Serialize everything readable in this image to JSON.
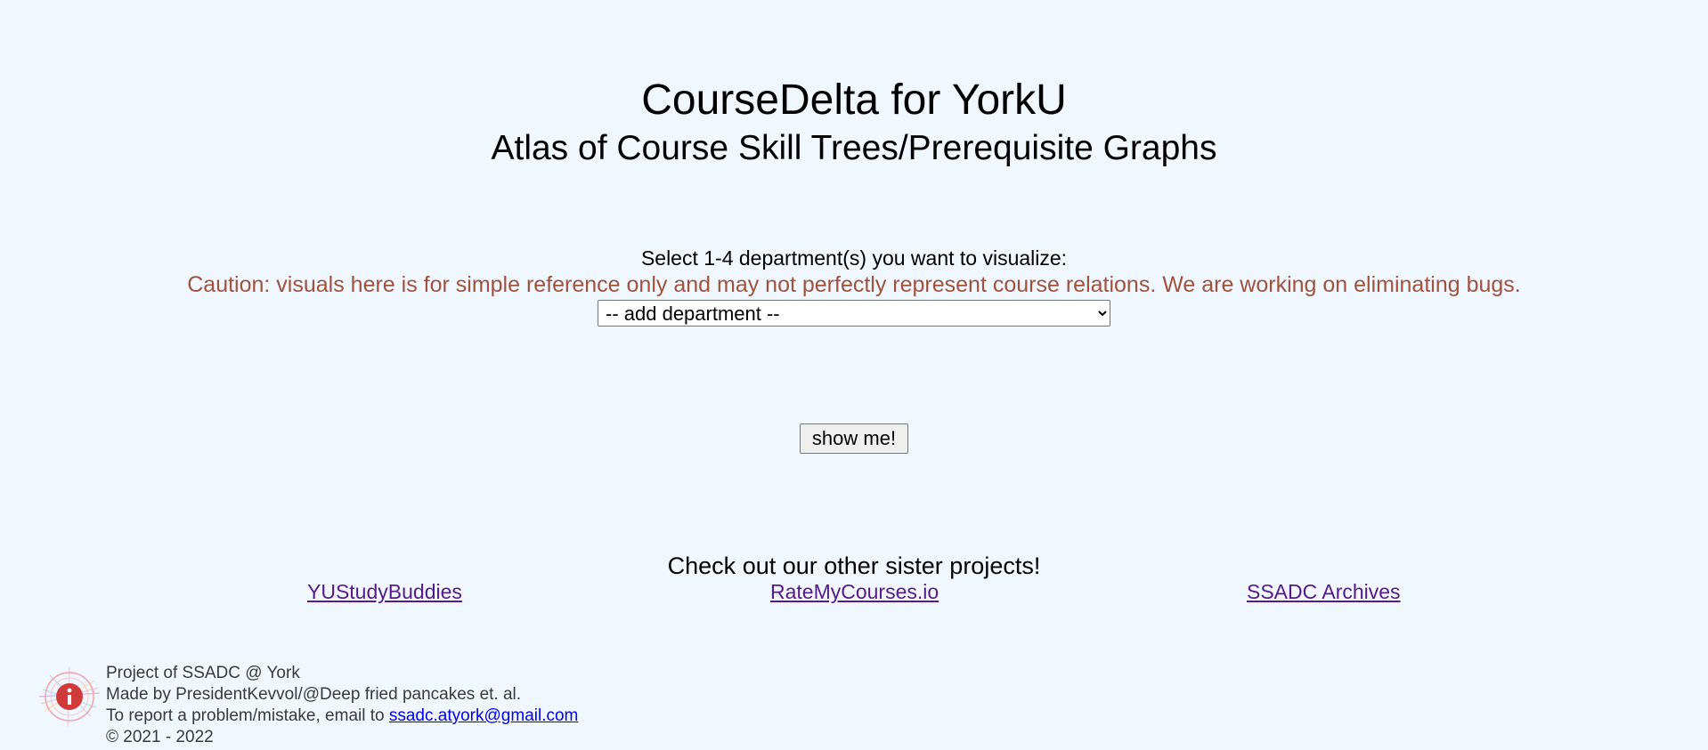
{
  "header": {
    "title": "CourseDelta for YorkU",
    "subtitle": "Atlas of Course Skill Trees/Prerequisite Graphs"
  },
  "selector": {
    "label": "Select 1-4 department(s) you want to visualize:",
    "caution": "Caution: visuals here is for simple reference only and may not perfectly represent course relations. We are working on eliminating bugs.",
    "selected_option": "-- add department --",
    "submit_label": "show me!"
  },
  "sister_projects": {
    "heading": "Check out our other sister projects!",
    "links": [
      {
        "label": "YUStudyBuddies"
      },
      {
        "label": "RateMyCourses.io"
      },
      {
        "label": "SSADC Archives"
      }
    ]
  },
  "footer": {
    "logo_icon": "info-icon",
    "line1": "Project of SSADC @ York",
    "line2": "Made by PresidentKevvol/@Deep fried pancakes et. al.",
    "line3_prefix": "To report a problem/mistake, email to ",
    "email": "ssadc.atyork@gmail.com",
    "line4": "© 2021 - 2022"
  },
  "colors": {
    "background": "#f0f7ff",
    "caution": "#a0523d",
    "visited_link": "#551a8b",
    "email_link": "#0000ee"
  }
}
